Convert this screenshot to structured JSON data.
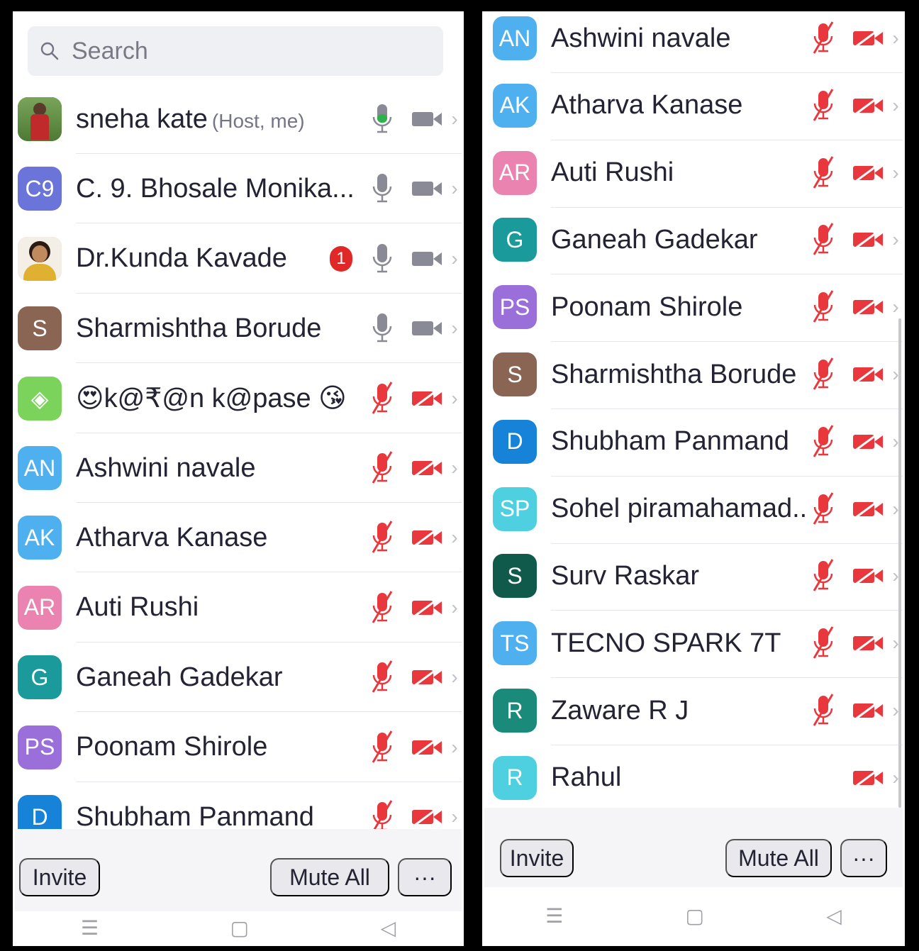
{
  "search": {
    "placeholder": "Search"
  },
  "left_list": [
    {
      "initials": "",
      "photo": "photo-1",
      "color": "#6b8f4e",
      "name": "sneha kate",
      "role": "(Host, me)",
      "mic": "on-active",
      "cam": "on"
    },
    {
      "initials": "C9",
      "color": "#6a74d9",
      "name": "C. 9. Bhosale Monika...",
      "mic": "on",
      "cam": "on"
    },
    {
      "initials": "",
      "photo": "photo-2",
      "color": "#c9a15c",
      "name": "Dr.Kunda Kavade",
      "badge": "1",
      "mic": "on",
      "cam": "on"
    },
    {
      "initials": "S",
      "color": "#8b6554",
      "name": "Sharmishtha Borude",
      "mic": "on",
      "cam": "on"
    },
    {
      "initials": "◈",
      "color": "#7bd35c",
      "name": "😍k@₹@n k@pase 😘",
      "mic": "muted",
      "cam": "off"
    },
    {
      "initials": "AN",
      "color": "#4fb0f0",
      "name": "Ashwini navale",
      "mic": "muted",
      "cam": "off"
    },
    {
      "initials": "AK",
      "color": "#4fb0f0",
      "name": "Atharva Kanase",
      "mic": "muted",
      "cam": "off"
    },
    {
      "initials": "AR",
      "color": "#ea83b0",
      "name": "Auti Rushi",
      "mic": "muted",
      "cam": "off"
    },
    {
      "initials": "G",
      "color": "#1a9a9a",
      "name": "Ganeah Gadekar",
      "mic": "muted",
      "cam": "off"
    },
    {
      "initials": "PS",
      "color": "#9b6fd9",
      "name": "Poonam Shirole",
      "mic": "muted",
      "cam": "off"
    },
    {
      "initials": "D",
      "color": "#1683d8",
      "name": "Shubham Panmand",
      "mic": "muted",
      "cam": "off"
    }
  ],
  "right_list": [
    {
      "initials": "AN",
      "color": "#4fb0f0",
      "name": "Ashwini navale",
      "mic": "muted",
      "cam": "off"
    },
    {
      "initials": "AK",
      "color": "#4fb0f0",
      "name": "Atharva Kanase",
      "mic": "muted",
      "cam": "off"
    },
    {
      "initials": "AR",
      "color": "#ea83b0",
      "name": "Auti Rushi",
      "mic": "muted",
      "cam": "off"
    },
    {
      "initials": "G",
      "color": "#1a9a9a",
      "name": "Ganeah Gadekar",
      "mic": "muted",
      "cam": "off"
    },
    {
      "initials": "PS",
      "color": "#9b6fd9",
      "name": "Poonam Shirole",
      "mic": "muted",
      "cam": "off"
    },
    {
      "initials": "S",
      "color": "#8b6554",
      "name": "Sharmishtha Borude",
      "mic": "muted",
      "cam": "off"
    },
    {
      "initials": "D",
      "color": "#1683d8",
      "name": "Shubham Panmand",
      "mic": "muted",
      "cam": "off"
    },
    {
      "initials": "SP",
      "color": "#4fd0e0",
      "name": "Sohel piramahamad...",
      "mic": "muted",
      "cam": "off"
    },
    {
      "initials": "S",
      "color": "#0f5a4a",
      "name": "Surv Raskar",
      "mic": "muted",
      "cam": "off"
    },
    {
      "initials": "TS",
      "color": "#4fb0f0",
      "name": "TECNO SPARK 7T",
      "mic": "muted",
      "cam": "off"
    },
    {
      "initials": "R",
      "color": "#1a8a7a",
      "name": "Zaware R J",
      "mic": "muted",
      "cam": "off"
    },
    {
      "initials": "R",
      "color": "#4fd0e0",
      "name": "Rahul",
      "mic": "none",
      "cam": "off"
    }
  ],
  "footer": {
    "invite": "Invite",
    "mute_all": "Mute All",
    "more": "···"
  },
  "colors": {
    "muted": "#e8383d",
    "active_mic": "#2db34a",
    "icon_gray": "#8a8a96"
  }
}
